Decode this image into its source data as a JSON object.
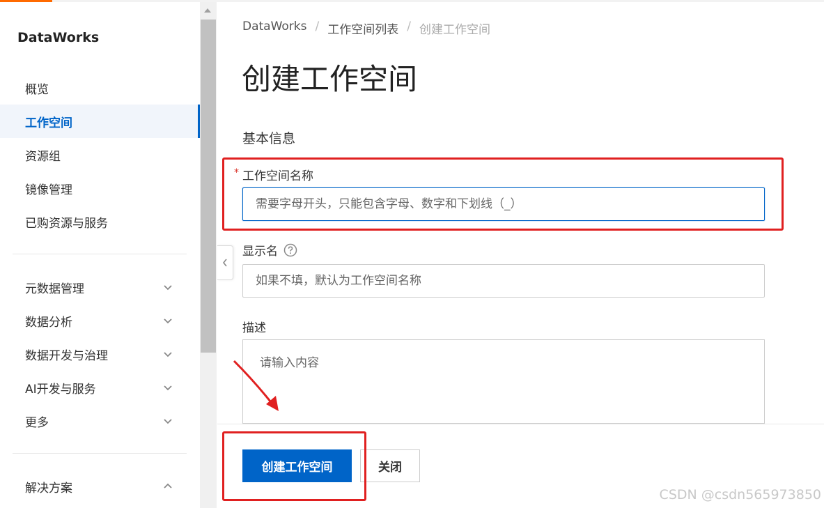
{
  "sidebar": {
    "brand": "DataWorks",
    "items": [
      {
        "label": "概览"
      },
      {
        "label": "工作空间"
      },
      {
        "label": "资源组"
      },
      {
        "label": "镜像管理"
      },
      {
        "label": "已购资源与服务"
      }
    ],
    "groups": [
      {
        "label": "元数据管理"
      },
      {
        "label": "数据分析"
      },
      {
        "label": "数据开发与治理"
      },
      {
        "label": "AI开发与服务"
      },
      {
        "label": "更多"
      }
    ],
    "solutions": {
      "label": "解决方案"
    }
  },
  "breadcrumb": [
    "DataWorks",
    "工作空间列表",
    "创建工作空间"
  ],
  "page_title": "创建工作空间",
  "section_title": "基本信息",
  "form": {
    "name": {
      "required_mark": "*",
      "label": "工作空间名称",
      "placeholder": "需要字母开头，只能包含字母、数字和下划线（_）"
    },
    "display_name": {
      "label": "显示名",
      "placeholder": "如果不填，默认为工作空间名称"
    },
    "description": {
      "label": "描述",
      "placeholder": "请输入内容"
    }
  },
  "buttons": {
    "create": "创建工作空间",
    "close": "关闭"
  },
  "watermark": "CSDN @csdn565973850",
  "colors": {
    "accent": "#0064c8",
    "highlight": "#e02020",
    "brand_orange": "#ff6a00"
  }
}
